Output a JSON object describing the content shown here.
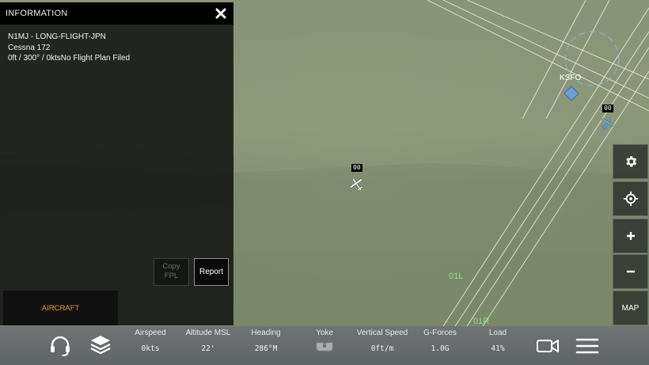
{
  "info_panel": {
    "title": "INFORMATION",
    "callsign_line": "N1MJ - LONG-FLIGHT-JPN",
    "aircraft_line": "Cessna 172",
    "status_line": "0ft / 300° / 0ktsNo Flight Plan Filed",
    "copy_fpl_line1": "Copy",
    "copy_fpl_line2": "FPL",
    "report_label": "Report",
    "aircraft_tab": "AIRCRAFT"
  },
  "map": {
    "airport_label": "KSFO",
    "runway_label_1": "01L",
    "runway_label_2": "01R",
    "self_aircraft_tag": "00",
    "other_aircraft_tag": "00"
  },
  "side_toolbar": {
    "map_label": "MAP"
  },
  "bottom_bar": {
    "stats": [
      {
        "label": "Airspeed",
        "value": "0kts"
      },
      {
        "label": "Altitude MSL",
        "value": "22'"
      },
      {
        "label": "Heading",
        "value": "286°M"
      },
      {
        "label": "Yoke",
        "value": ""
      },
      {
        "label": "Vertical Speed",
        "value": "0ft/m"
      },
      {
        "label": "G-Forces",
        "value": "1.0G"
      },
      {
        "label": "Load",
        "value": "41%"
      }
    ]
  },
  "colors": {
    "accent_orange": "#e7962f",
    "runway_label_green": "#8fe07a",
    "airport_marker_blue": "#6c9fd6"
  }
}
